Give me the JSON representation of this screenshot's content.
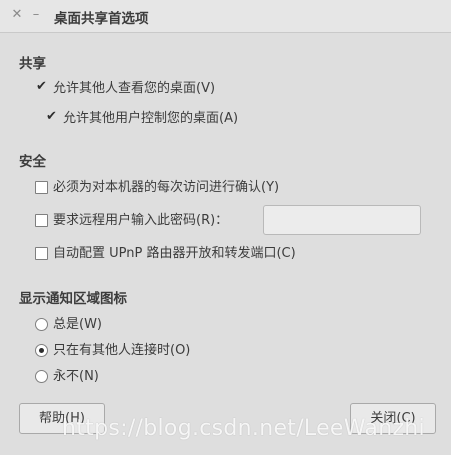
{
  "window": {
    "title": "桌面共享首选项",
    "close_glyph": "✕",
    "minimize_glyph": "–"
  },
  "sharing": {
    "heading": "共享",
    "allow_view": {
      "label": "允许其他人查看您的桌面(V)",
      "checked": true
    },
    "allow_control": {
      "label": "允许其他用户控制您的桌面(A)",
      "checked": true
    }
  },
  "security": {
    "heading": "安全",
    "confirm_each": {
      "label": "必须为对本机器的每次访问进行确认(Y)",
      "checked": false
    },
    "require_password": {
      "label": "要求远程用户输入此密码(R)：",
      "checked": false,
      "value": ""
    },
    "upnp": {
      "label": "自动配置 UPnP 路由器开放和转发端口(C)",
      "checked": false
    }
  },
  "notify": {
    "heading": "显示通知区域图标",
    "options": [
      {
        "label": "总是(W)",
        "selected": false
      },
      {
        "label": "只在有其他人连接时(O)",
        "selected": true
      },
      {
        "label": "永不(N)",
        "selected": false
      }
    ]
  },
  "buttons": {
    "help": "帮助(H)",
    "close": "关闭(C)"
  },
  "watermark": "https://blog.csdn.net/LeeWanzhi"
}
